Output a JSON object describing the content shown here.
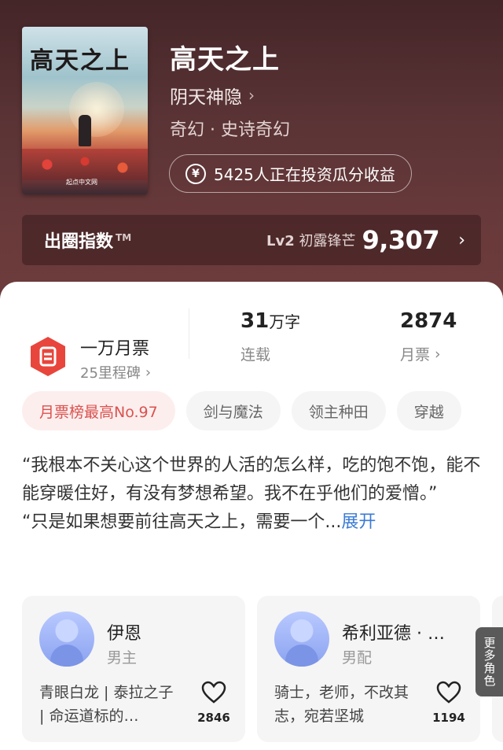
{
  "book": {
    "cover_title": "高天之上",
    "cover_publisher": "起点中文网",
    "title": "高天之上",
    "author": "阴天神隐",
    "genre": "奇幻 · 史诗奇幻",
    "invest_text": "5425人正在投资瓜分收益"
  },
  "index_bar": {
    "label": "出圈指数",
    "tm": "TM",
    "level_code": "Lv2",
    "level_name": "初露锋芒",
    "value": "9,307"
  },
  "stats": {
    "ticket_title": "一万月票",
    "ticket_sub": "25里程碑",
    "words_value": "31",
    "words_unit": "万字",
    "status": "连载",
    "monthly_votes": "2874",
    "monthly_label": "月票"
  },
  "tags": [
    "月票榜最高No.97",
    "剑与魔法",
    "领主种田",
    "穿越"
  ],
  "description": {
    "line1": "“我根本不关心这个世界的人活的怎么样，吃的饱不饱，能不能穿暖住好，有没有梦想希望。我不在乎他们的爱憎。”",
    "line2": "“只是如果想要前往高天之上，需要一个...",
    "expand": "展开"
  },
  "characters": [
    {
      "name": "伊恩",
      "role": "男主",
      "desc": "青眼白龙 | 泰拉之子 | 命运道标的…",
      "likes": "2846"
    },
    {
      "name": "希利亚德 · …",
      "role": "男配",
      "desc": "骑士，老师，不改其志，宛若坚城",
      "likes": "1194"
    }
  ],
  "more_roles": "更多角色",
  "icons": {
    "author_chevron": "chevron-right-icon",
    "yen": "yen-coin-icon",
    "ticket": "ticket-icon",
    "heart": "heart-outline-icon"
  },
  "colors": {
    "accent_red": "#e8453c",
    "link_blue": "#3b7bd4"
  }
}
